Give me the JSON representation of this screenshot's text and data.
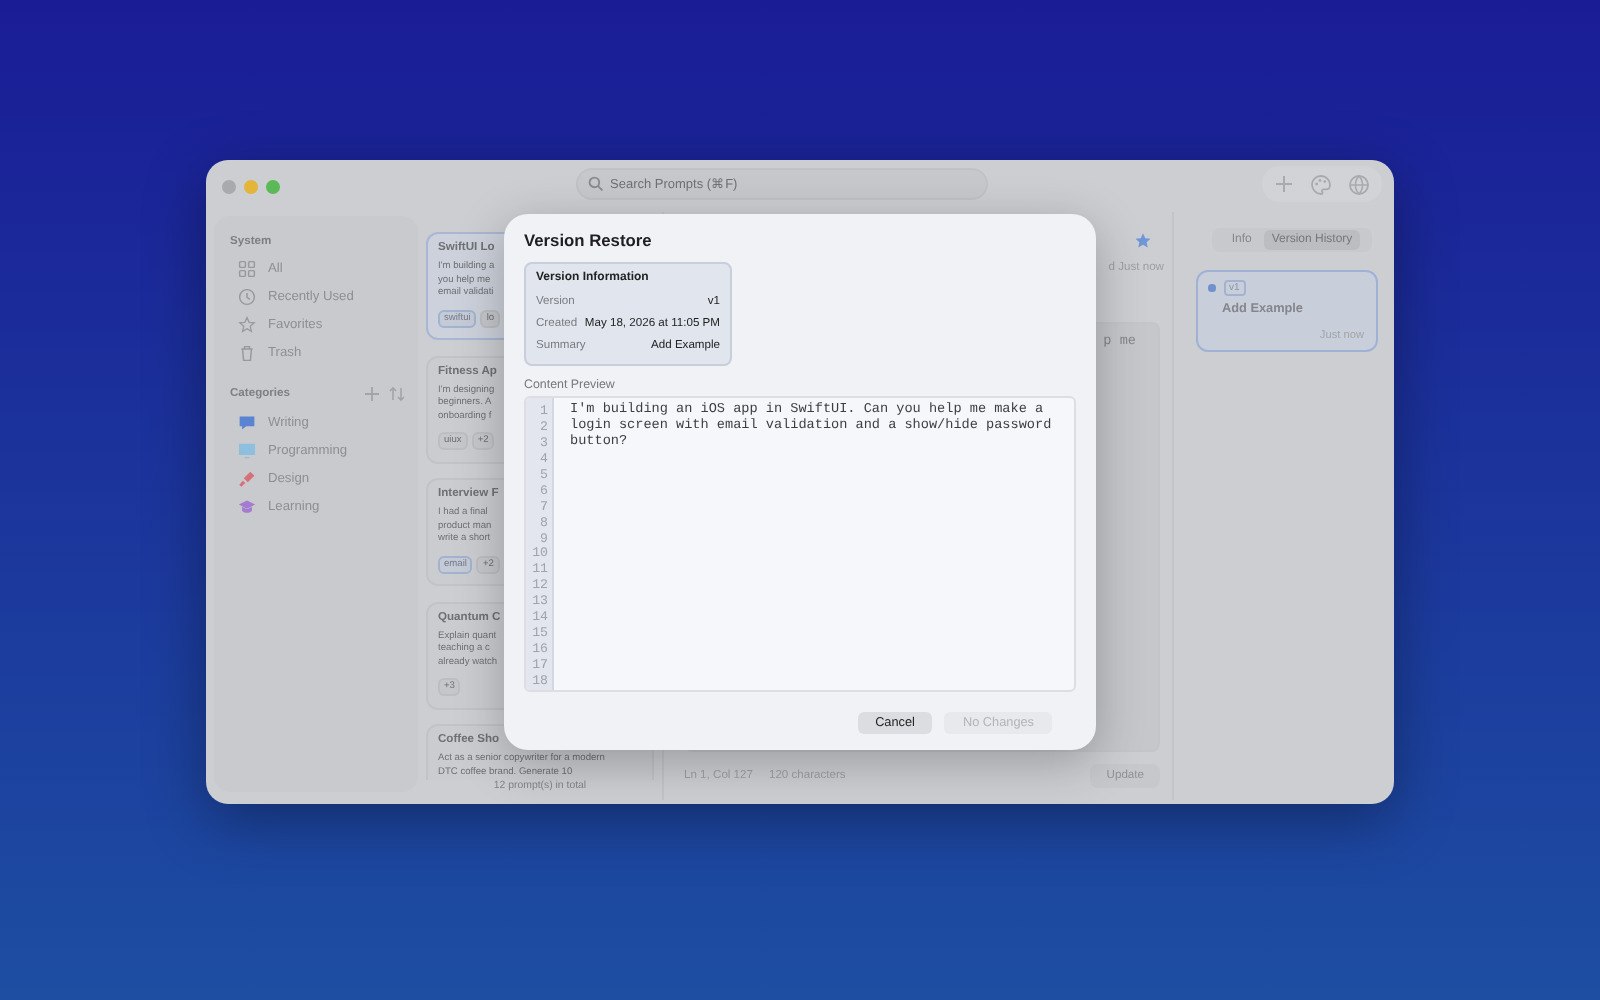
{
  "window": {
    "search": {
      "placeholder": "Search Prompts (⌘F)"
    }
  },
  "sidebar": {
    "sections": [
      {
        "title": "System",
        "items": [
          {
            "label": "All",
            "kind": "all"
          },
          {
            "label": "Recently Used",
            "kind": "recent"
          },
          {
            "label": "Favorites",
            "kind": "favorites"
          },
          {
            "label": "Trash",
            "kind": "trash"
          }
        ]
      },
      {
        "title": "Categories",
        "items": [
          {
            "label": "Writing",
            "kind": "writing",
            "color": "#5a84d2"
          },
          {
            "label": "Programming",
            "kind": "programming",
            "color": "#8ebfde"
          },
          {
            "label": "Design",
            "kind": "design",
            "color": "#d8707a"
          },
          {
            "label": "Learning",
            "kind": "learning",
            "color": "#a57bcf"
          }
        ]
      }
    ]
  },
  "prompt_list": {
    "cards": [
      {
        "title": "SwiftUI Lo",
        "lines": [
          "I'm building a",
          "you help me",
          "email validati"
        ],
        "tags": [
          {
            "label": "swiftui",
            "highlighted": true
          },
          {
            "label": "lo",
            "highlighted": false
          }
        ],
        "selected": true
      },
      {
        "title": "Fitness Ap",
        "lines": [
          "I'm designing",
          "beginners. A",
          "onboarding f"
        ],
        "tags": [
          {
            "label": "uiux",
            "highlighted": false
          },
          {
            "label": "+2",
            "highlighted": false
          }
        ],
        "selected": false
      },
      {
        "title": "Interview F",
        "lines": [
          "I had a final",
          "product man",
          "write a short"
        ],
        "tags": [
          {
            "label": "email",
            "highlighted": true
          },
          {
            "label": "+2",
            "highlighted": false
          }
        ],
        "selected": false
      },
      {
        "title": "Quantum C",
        "lines": [
          "Explain quant",
          "teaching a c",
          "already watch"
        ],
        "tags": [
          {
            "label": "+3",
            "highlighted": false
          }
        ],
        "selected": false
      },
      {
        "title": "Coffee Sho",
        "lines": [
          "Act as a senior copywriter for a modern",
          "DTC coffee brand. Generate 10"
        ],
        "selected": false
      }
    ],
    "footer": "12 prompt(s) in total"
  },
  "editor": {
    "modified": "d Just now",
    "favorite": true,
    "content_fragment": "p me",
    "status": [
      "Ln 1, Col 127",
      "120 characters"
    ],
    "update_button": "Update"
  },
  "inspector": {
    "tabs": [
      {
        "label": "Info",
        "selected": false
      },
      {
        "label": "Version History",
        "selected": true
      }
    ],
    "versions": [
      {
        "badge": "v1",
        "summary": "Add Example",
        "time": "Just now",
        "selected": true
      }
    ]
  },
  "dialog": {
    "title": "Version Restore",
    "info": {
      "title": "Version Information",
      "rows": [
        {
          "label": "Version",
          "value": "v1"
        },
        {
          "label": "Created",
          "value": "May 18, 2026 at 11:05 PM"
        },
        {
          "label": "Summary",
          "value": "Add Example"
        }
      ]
    },
    "preview_label": "Content Preview",
    "line_numbers": [
      "1",
      "2",
      "3",
      "4",
      "5",
      "6",
      "7",
      "8",
      "9",
      "10",
      "11",
      "12",
      "13",
      "14",
      "15",
      "16",
      "17",
      "18"
    ],
    "content_lines": [
      "I'm building an iOS app in SwiftUI. Can you help me make a",
      "login screen with email validation and a show/hide password",
      "button?"
    ],
    "buttons": [
      {
        "label": "Cancel",
        "disabled": false
      },
      {
        "label": "No Changes",
        "disabled": true
      }
    ]
  }
}
